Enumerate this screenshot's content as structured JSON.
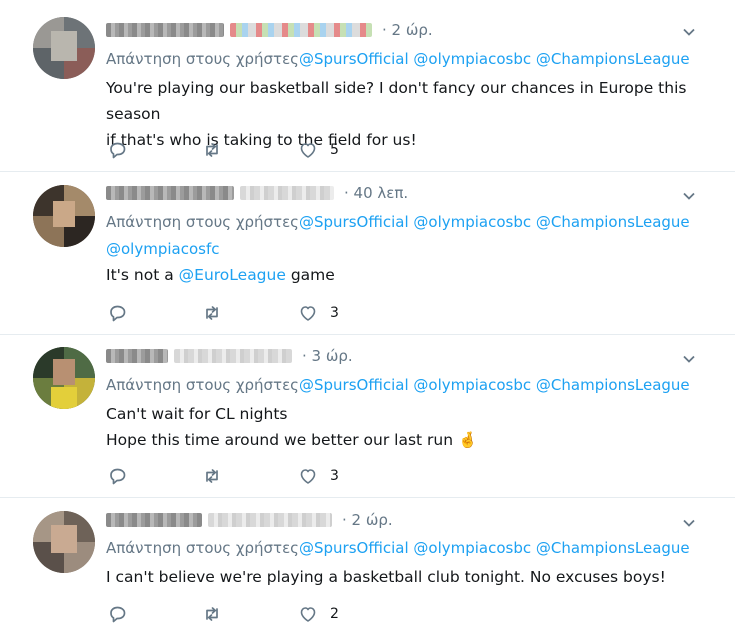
{
  "tweets": [
    {
      "time": "· 2 ώρ.",
      "reply_prefix": "Απάντηση στους χρήστες",
      "mentions": [
        "@SpursOfficial",
        "@olympiacosbc",
        "@ChampionsLeague"
      ],
      "text_lines": [
        "You're playing our basketball side? I don't fancy our chances in Europe this season",
        "if that's who is taking to the field for us!"
      ],
      "likes": "5"
    },
    {
      "time": "· 40 λεπ.",
      "reply_prefix": "Απάντηση στους χρήστες",
      "mentions": [
        "@SpursOfficial",
        "@olympiacosbc",
        "@ChampionsLeague",
        "@olympiacosfc"
      ],
      "text_before": "It's not a ",
      "text_mention": "@EuroLeague",
      "text_after": " game",
      "likes": "3"
    },
    {
      "time": "· 3 ώρ.",
      "reply_prefix": "Απάντηση στους χρήστες",
      "mentions": [
        "@SpursOfficial",
        "@olympiacosbc",
        "@ChampionsLeague"
      ],
      "text_lines": [
        "Can't wait for CL nights",
        "Hope this time around we better our last run"
      ],
      "emoji": "🤞",
      "likes": "3"
    },
    {
      "time": "· 2 ώρ.",
      "reply_prefix": "Απάντηση στους χρήστες",
      "mentions": [
        "@SpursOfficial",
        "@olympiacosbc",
        "@ChampionsLeague"
      ],
      "text_lines": [
        "I can't believe we're playing a basketball club tonight. No excuses boys!"
      ],
      "likes": "2"
    }
  ],
  "icons": {
    "reply": "reply-icon",
    "retweet": "retweet-icon",
    "like": "heart-icon",
    "more": "chevron-down-icon"
  },
  "colors": {
    "mention": "#1da1f2",
    "secondary_text": "#657786",
    "divider": "#e6ecf0"
  }
}
